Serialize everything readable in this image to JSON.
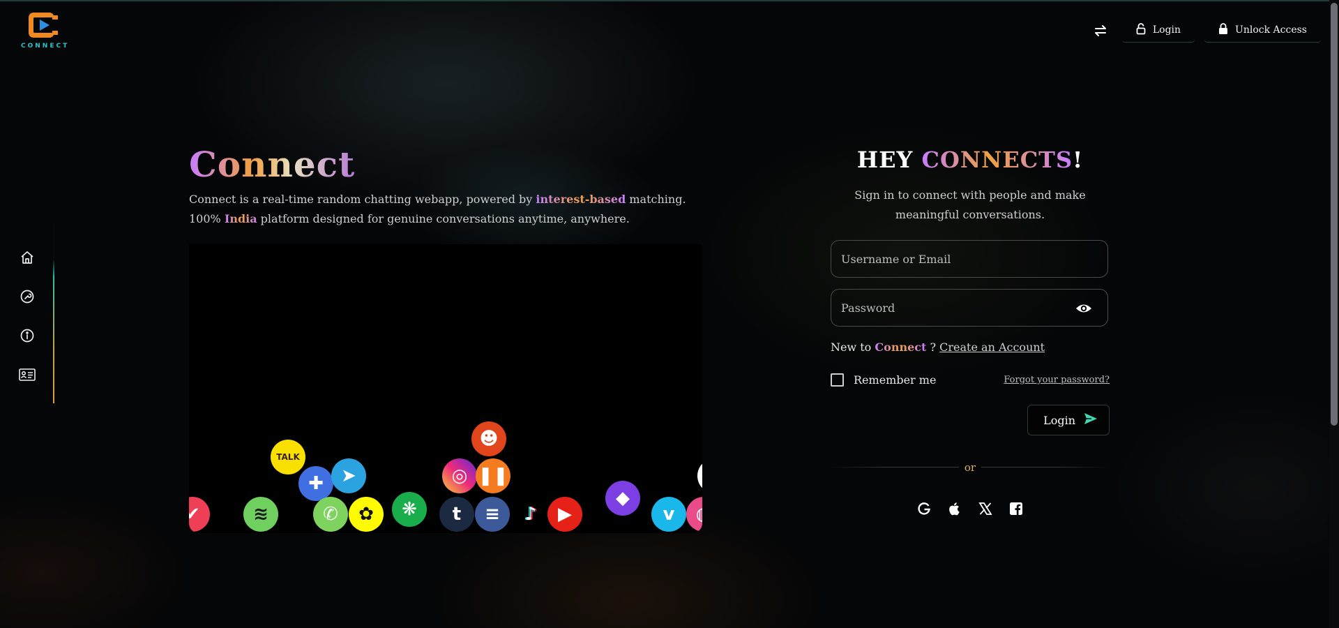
{
  "brand": {
    "logo_text": "CONNECT"
  },
  "topnav": {
    "swap_icon": "swap-arrows-icon",
    "login_label": "Login",
    "unlock_label": "Unlock Access"
  },
  "siderail": {
    "items": [
      {
        "name": "home",
        "icon": "home-icon"
      },
      {
        "name": "tools",
        "icon": "wrench-icon"
      },
      {
        "name": "info",
        "icon": "info-icon"
      },
      {
        "name": "contact",
        "icon": "id-card-icon"
      }
    ]
  },
  "hero": {
    "title": "Connect",
    "desc_part1": "Connect is a real-time random chatting webapp, powered by ",
    "desc_highlight": "interest-based",
    "desc_part2": " matching. 100% ",
    "desc_highlight2": "India",
    "desc_part3": " platform designed for genuine conversations anytime, anywhere."
  },
  "bubbles": [
    {
      "name": "kakaotalk",
      "label": "TALK",
      "color": "#f9e000",
      "text": "#3b1e1e"
    },
    {
      "name": "feather",
      "label": "✚",
      "color": "#3f6fe0",
      "text": "#ffffff"
    },
    {
      "name": "telegram",
      "label": "➤",
      "color": "#2aa3e0",
      "text": "#ffffff"
    },
    {
      "name": "reddit",
      "label": "☻",
      "color": "#e0451c",
      "text": "#ffffff"
    },
    {
      "name": "instagram",
      "label": "◎",
      "color": "#c13584",
      "text": "#ffffff"
    },
    {
      "name": "soundcloud",
      "label": "❚❚",
      "color": "#f47b20",
      "text": "#ffffff"
    },
    {
      "name": "pocket",
      "label": "✔",
      "color": "#ef3f56",
      "text": "#ffffff"
    },
    {
      "name": "spotify",
      "label": "≋",
      "color": "#6fcf5f",
      "text": "#1b1b1b"
    },
    {
      "name": "whatsapp",
      "label": "✆",
      "color": "#7ed35f",
      "text": "#ffffff"
    },
    {
      "name": "snapchat",
      "label": "✿",
      "color": "#fffc00",
      "text": "#111111"
    },
    {
      "name": "wechat",
      "label": "❋",
      "color": "#1aad4b",
      "text": "#ffffff"
    },
    {
      "name": "tumblr",
      "label": "t",
      "color": "#1b2a40",
      "text": "#ffffff"
    },
    {
      "name": "wordpress",
      "label": "≡",
      "color": "#3c5a99",
      "text": "#ffffff"
    },
    {
      "name": "tiktok",
      "label": "♪",
      "color": "#000000",
      "text": "#ffffff"
    },
    {
      "name": "youtube",
      "label": "▶",
      "color": "#e62117",
      "text": "#ffffff"
    },
    {
      "name": "twitch",
      "label": "◆",
      "color": "#7b3fe4",
      "text": "#ffffff"
    },
    {
      "name": "vimeo",
      "label": "v",
      "color": "#1ab7ea",
      "text": "#ffffff"
    },
    {
      "name": "dribbble",
      "label": "◍",
      "color": "#ea4c89",
      "text": "#ffffff"
    },
    {
      "name": "white-circle",
      "label": "",
      "color": "#ffffff",
      "text": "#000000"
    }
  ],
  "login": {
    "title_prefix": "HEY ",
    "title_highlight": "CONNECTS",
    "title_suffix": "!",
    "subtitle": "Sign in to connect with people and make meaningful conversations.",
    "username_placeholder": "Username or Email",
    "password_placeholder": "Password",
    "new_to": "New to ",
    "brand": "Connect",
    "question": " ? ",
    "create_account": "Create an Account",
    "remember_me": "Remember me",
    "forgot_password": "Forgot your password?",
    "login_button": "Login",
    "or": "or"
  },
  "social": [
    {
      "name": "google",
      "icon": "google-icon",
      "glyph": "G"
    },
    {
      "name": "apple",
      "icon": "apple-icon",
      "glyph": ""
    },
    {
      "name": "x",
      "icon": "x-icon",
      "glyph": "𝕏"
    },
    {
      "name": "facebook",
      "icon": "facebook-icon",
      "glyph": "f"
    }
  ],
  "colors": {
    "accent_purple": "#c77dff",
    "accent_orange": "#f0a040",
    "logo_orange": "#f08a20",
    "logo_teal": "#28c4c8"
  }
}
